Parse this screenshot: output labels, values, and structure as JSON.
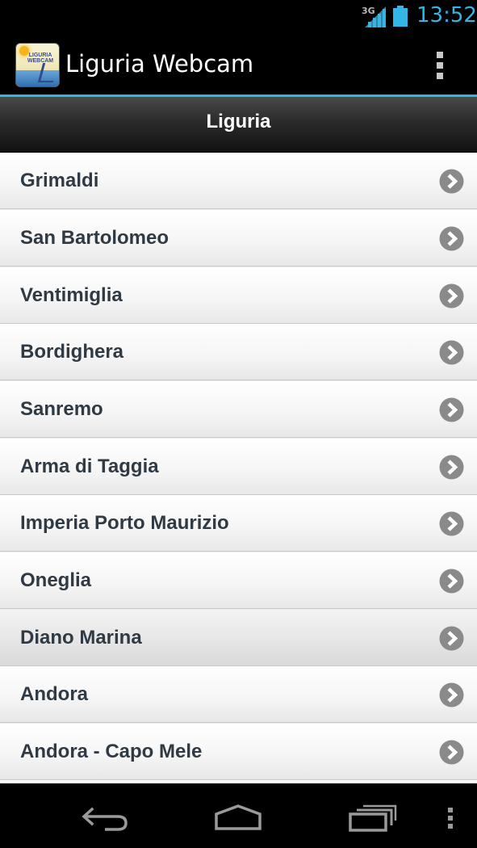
{
  "status_bar": {
    "network": "3G",
    "time": "13:52",
    "colors": {
      "accent": "#33b5e5",
      "icons": "#33b5e5"
    }
  },
  "action_bar": {
    "title": "Liguria Webcam",
    "icon_text": "LIGURIA WEBCAM",
    "overflow_icon": "overflow-menu-icon"
  },
  "header": {
    "title": "Liguria"
  },
  "list": {
    "items": [
      {
        "label": "Grimaldi"
      },
      {
        "label": "San Bartolomeo"
      },
      {
        "label": "Ventimiglia"
      },
      {
        "label": "Bordighera"
      },
      {
        "label": "Sanremo"
      },
      {
        "label": "Arma di Taggia"
      },
      {
        "label": "Imperia Porto Maurizio"
      },
      {
        "label": "Oneglia"
      },
      {
        "label": "Diano Marina"
      },
      {
        "label": "Andora"
      },
      {
        "label": "Andora - Capo Mele"
      }
    ],
    "chevron_icon": "chevron-right-circle-icon"
  },
  "nav_bar": {
    "back_icon": "back-icon",
    "home_icon": "home-icon",
    "recent_icon": "recent-apps-icon",
    "menu_icon": "menu-icon"
  }
}
